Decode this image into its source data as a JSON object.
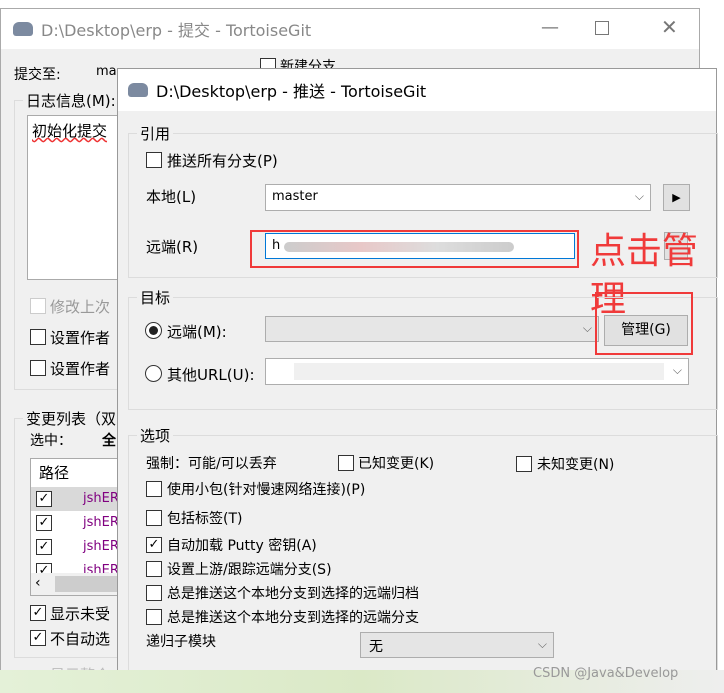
{
  "commit_window": {
    "title": "D:\\Desktop\\erp - 提交 - TortoiseGit",
    "commit_to_label": "提交至:",
    "branch": "ma",
    "new_branch": "新建分支",
    "log_label": "日志信息(M):",
    "message": "初始化提交",
    "amend": "修改上次",
    "set_author": "设置作者",
    "set_date": "设置作者",
    "changes_label": "变更列表（双",
    "selected_label": "选中：",
    "selected_all": "全",
    "path_header": "路径",
    "files": [
      "jshER",
      "jshER",
      "jshER",
      "jshER"
    ],
    "show_unversioned": "显示未受",
    "no_autoselect": "不自动选",
    "show_whole": "显示整个"
  },
  "push_window": {
    "title": "D:\\Desktop\\erp - 推送 - TortoiseGit",
    "ref": {
      "legend": "引用",
      "push_all": "推送所有分支(P)",
      "local_label": "本地(L)",
      "local_value": "master",
      "remote_label": "远端(R)",
      "remote_value": "h"
    },
    "dest": {
      "legend": "目标",
      "remote_radio": "远端(M):",
      "manage_button": "管理(G)",
      "other_url": "其他URL(U):"
    },
    "options": {
      "legend": "选项",
      "force_label": "强制：可能/可以丢弃",
      "known_changes": "已知变更(K)",
      "unknown_changes": "未知变更(N)",
      "thin_pack": "使用小包(针对慢速网络连接)(P)",
      "include_tags": "包括标签(T)",
      "autoload_putty": "自动加载 Putty 密钥(A)",
      "set_upstream": "设置上游/跟踪远端分支(S)",
      "always_archive": "总是推送这个本地分支到选择的远端归档",
      "always_branch": "总是推送这个本地分支到选择的远端分支",
      "recurse_label": "递归子模块",
      "recurse_value": "无"
    },
    "checks": {
      "push_all": false,
      "known": false,
      "unknown": false,
      "thin": false,
      "tags": false,
      "putty": true,
      "upstream": false,
      "archive": false,
      "branch": false
    }
  },
  "annotation": {
    "text1": "点击管",
    "text2": "理",
    "color": "#f03a3a"
  },
  "watermark": "CSDN @Java&Develop"
}
